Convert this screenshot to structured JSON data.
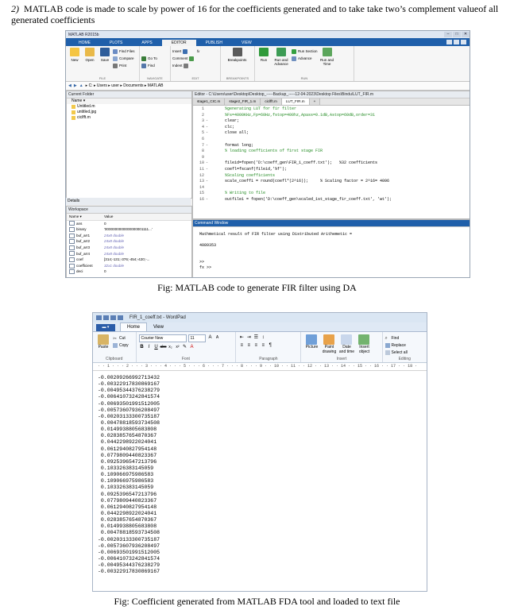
{
  "heading": {
    "number": "2)",
    "text": "MATLAB code is made to scale by power of 16 for the coefficients generated and to take take two’s complement valueof all generated coefficients"
  },
  "matlab": {
    "title": "MATLAB R2015b",
    "tabs": [
      "HOME",
      "PLOTS",
      "APPS",
      "EDITOR",
      "PUBLISH",
      "VIEW"
    ],
    "active_tab": "EDITOR",
    "ribbon": {
      "new": "New",
      "open": "Open",
      "save": "Save",
      "find_files": "Find Files",
      "compare": "Compare",
      "print": "Print",
      "insert": "Insert",
      "fx": "fx",
      "goto": "Go To",
      "comment": "Comment",
      "find": "Find",
      "indent": "Indent",
      "breakpoints": "Breakpoints",
      "run": "Run",
      "run_and_advance": "Run and Advance",
      "run_section": "Run Section",
      "advance": "Advance",
      "run_and_time": "Run and Time",
      "group_file": "FILE",
      "group_navigate": "NAVIGATE",
      "group_edit": "EDIT",
      "group_breakpoints": "BREAKPOINTS",
      "group_run": "RUN"
    },
    "address": "▸ C: ▸ Users ▸ user ▸ Documents ▸ MATLAB",
    "current_folder": {
      "title": "Current Folder",
      "name_header": "Name ▾",
      "files": [
        "Untitled.m",
        "untitled.jpg",
        "ciclfft.m"
      ]
    },
    "details_label": "Details",
    "workspace": {
      "title": "Workspace",
      "headers": [
        "Name ▾",
        "Value"
      ],
      "rows": [
        [
          "ans",
          "0"
        ],
        [
          "binary",
          "'0000000000000000001111...'"
        ],
        [
          "buf_arr1",
          "24x8 double"
        ],
        [
          "buf_arr2",
          "24x8 double"
        ],
        [
          "buf_arr3",
          "24x8 double"
        ],
        [
          "buf_arr4",
          "24x8 double"
        ],
        [
          "coef",
          "[314;-131;-376;-454;-420;-..."
        ],
        [
          "coefficient",
          "32x1 double"
        ],
        [
          "deci",
          "0"
        ]
      ]
    },
    "editor": {
      "title": "Editor - C:\\Users\\user\\Desktop\\Desktop_-----Backup_-----12-04-2023\\Desktop Files\\Bindu\\LUT_FIR.m",
      "tabs": [
        "stage1_CIC.m",
        "stage2_FIR_1.m",
        "ciclfft.m",
        "LUT_FIR.m",
        "+"
      ],
      "lines": [
        {
          "n": "1",
          "d": "",
          "t": "%generating LUT for fir filter",
          "c": "green"
        },
        {
          "n": "2",
          "d": "",
          "t": "%Fs=4000KHz,Fp=60Hz,fstop=400hz,Apass=0.1dB,Astop=60dB,order=31",
          "c": "green"
        },
        {
          "n": "3",
          "d": "-",
          "t": "clear;",
          "c": ""
        },
        {
          "n": "4",
          "d": "-",
          "t": "clc;",
          "c": ""
        },
        {
          "n": "5",
          "d": "-",
          "t": "close all;",
          "c": "mixed"
        },
        {
          "n": "6",
          "d": "",
          "t": "",
          "c": ""
        },
        {
          "n": "7",
          "d": "-",
          "t": "format long;",
          "c": "mixed"
        },
        {
          "n": "8",
          "d": "",
          "t": "% loading coefficients of first stage FIR",
          "c": "green"
        },
        {
          "n": "9",
          "d": "",
          "t": "",
          "c": ""
        },
        {
          "n": "10",
          "d": "-",
          "t": "fileid=fopen('D:\\coeff_gen\\FIR_1_coeff.txt');   %32 coefficients",
          "c": "code"
        },
        {
          "n": "11",
          "d": "-",
          "t": "coefl=fscanf(fileid,'%f');",
          "c": "code"
        },
        {
          "n": "12",
          "d": "",
          "t": "%Scaling coefficients",
          "c": "green"
        },
        {
          "n": "13",
          "d": "-",
          "t": "scale_coeff1 = round(coefl*(2^16));     % Scaling factor = 2^16= 4096",
          "c": "code"
        },
        {
          "n": "14",
          "d": "",
          "t": "",
          "c": ""
        },
        {
          "n": "15",
          "d": "",
          "t": "% Writing to file",
          "c": "green"
        },
        {
          "n": "16",
          "d": "-",
          "t": "outfile1 = fopen('D:\\coeff_gen\\scaled_1st_stage_fir_coeff.txt', 'wt');",
          "c": "code"
        }
      ]
    },
    "command_window": {
      "title": "Command Window",
      "lines": [
        "Mathmetical result of FIR filter using Distributed Arithemetic =",
        "",
        "   4089353",
        "",
        "",
        ">>",
        "fx >>"
      ]
    }
  },
  "caption1": "Fig: MATLAB code to generate FIR filter using DA",
  "wordpad": {
    "title": "FIR_1_coeff.txt - WordPad",
    "tabs": [
      "Home",
      "View"
    ],
    "clipboard": {
      "paste": "Paste",
      "cut": "Cut",
      "copy": "Copy",
      "label": "Clipboard"
    },
    "font": {
      "name": "Courier New",
      "size": "11",
      "label": "Font"
    },
    "paragraph_label": "Paragraph",
    "insert": {
      "picture": "Picture",
      "paint": "Paint drawing",
      "datetime": "Date and time",
      "object": "Insert object",
      "label": "Insert"
    },
    "editing": {
      "find": "Find",
      "replace": "Replace",
      "select_all": "Select all",
      "label": "Editing"
    },
    "ruler": "· · 1 · · · 2 · · · 3 · · · 4 · · · 5 · · · 6 · · · 7 · · · 8 · · · 9 · · 10 · · 11 · · 12 · · 13 · · 14 · · 15 · · 16 · · 17 · · 18 ·",
    "coefficients": [
      "-0.00209266992713432",
      "-0.00322917830869167",
      "-0.00495344376238279",
      "-0.00641073242841574",
      "-0.00693501991512005",
      "-0.00573607936208497",
      "-0.00203133300735187",
      " 0.00478818593734508",
      " 0.0149938805683808",
      " 0.0283857654870367",
      " 0.0442298922024041",
      " 0.0612940827954148",
      " 0.0779809440823367",
      " 0.0925396547213796",
      " 0.103326383145059",
      " 0.109066975986583",
      " 0.109066975986583",
      " 0.103326383145059",
      " 0.0925396547213796",
      " 0.0779809440823367",
      " 0.0612940827954148",
      " 0.0442298922024041",
      " 0.0283857654870367",
      " 0.0149938805683808",
      " 0.00478818593734508",
      "-0.00203133300735187",
      "-0.00573607936208497",
      "-0.00693501991512005",
      "-0.00641073242841574",
      "-0.00495344376238279",
      "-0.00322917830869167"
    ]
  },
  "caption2": "Fig: Coefficient generated from MATLAB FDA tool and loaded to text file"
}
